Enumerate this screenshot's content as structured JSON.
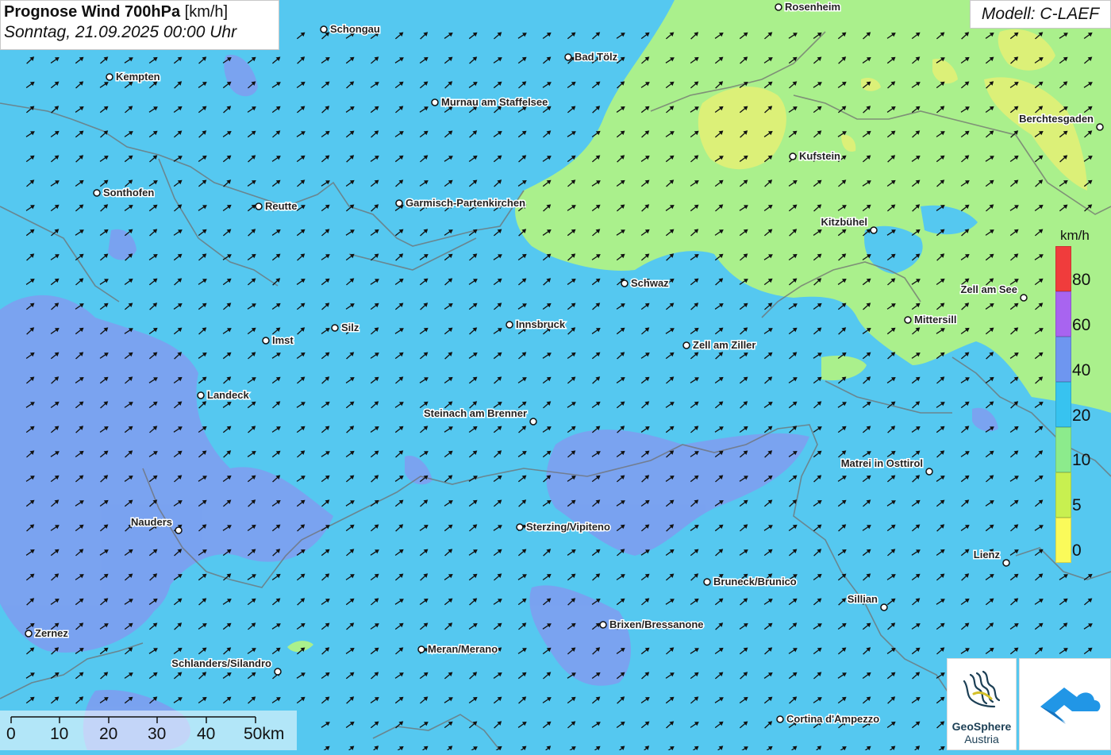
{
  "title": {
    "main_bold": "Prognose Wind 700hPa",
    "main_unit": "[km/h]",
    "subtitle": "Sonntag, 21.09.2025 00:00 Uhr"
  },
  "model_label": "Modell: C-LAEF",
  "legend": {
    "unit": "km/h",
    "ticks": [
      "80",
      "60",
      "40",
      "20",
      "10",
      "5",
      "0"
    ],
    "bands": [
      {
        "color": "#f03c3c"
      },
      {
        "color": "#a864f0"
      },
      {
        "color": "#6e96f0"
      },
      {
        "color": "#37c3f0"
      },
      {
        "color": "#8ceb8c"
      },
      {
        "color": "#c8f050"
      },
      {
        "color": "#fafa5a"
      }
    ]
  },
  "scalebar": {
    "ticks": [
      "0",
      "10",
      "20",
      "30",
      "40",
      "50km"
    ]
  },
  "logos": {
    "geosphere_name": "GeoSphere",
    "geosphere_sub": "Austria"
  },
  "colors": {
    "base_wind": "#55c8f0",
    "strong_wind": "#7e9ef0",
    "weak_wind": "#aaf08c",
    "very_weak_wind": "#dcf078",
    "arrow": "#111111"
  },
  "cities": [
    {
      "name": "Rosenheim"
    },
    {
      "name": "Schongau"
    },
    {
      "name": "Bad Tölz"
    },
    {
      "name": "Kempten"
    },
    {
      "name": "Murnau am Staffelsee"
    },
    {
      "name": "Berchtesgaden"
    },
    {
      "name": "Kufstein"
    },
    {
      "name": "Sonthofen"
    },
    {
      "name": "Reutte"
    },
    {
      "name": "Garmisch-Partenkirchen"
    },
    {
      "name": "Kitzbühel"
    },
    {
      "name": "Schwaz"
    },
    {
      "name": "Zell am See"
    },
    {
      "name": "Mittersill"
    },
    {
      "name": "Silz"
    },
    {
      "name": "Innsbruck"
    },
    {
      "name": "Imst"
    },
    {
      "name": "Zell am Ziller"
    },
    {
      "name": "Landeck"
    },
    {
      "name": "Steinach am Brenner"
    },
    {
      "name": "Matrei in Osttirol"
    },
    {
      "name": "Nauders"
    },
    {
      "name": "Sterzing/Vipiteno"
    },
    {
      "name": "Lienz"
    },
    {
      "name": "Bruneck/Brunico"
    },
    {
      "name": "Sillian"
    },
    {
      "name": "Brixen/Bressanone"
    },
    {
      "name": "Zernez"
    },
    {
      "name": "Meran/Merano"
    },
    {
      "name": "Schlanders/Silandro"
    },
    {
      "name": "Cortina d'Ampezzo"
    }
  ]
}
